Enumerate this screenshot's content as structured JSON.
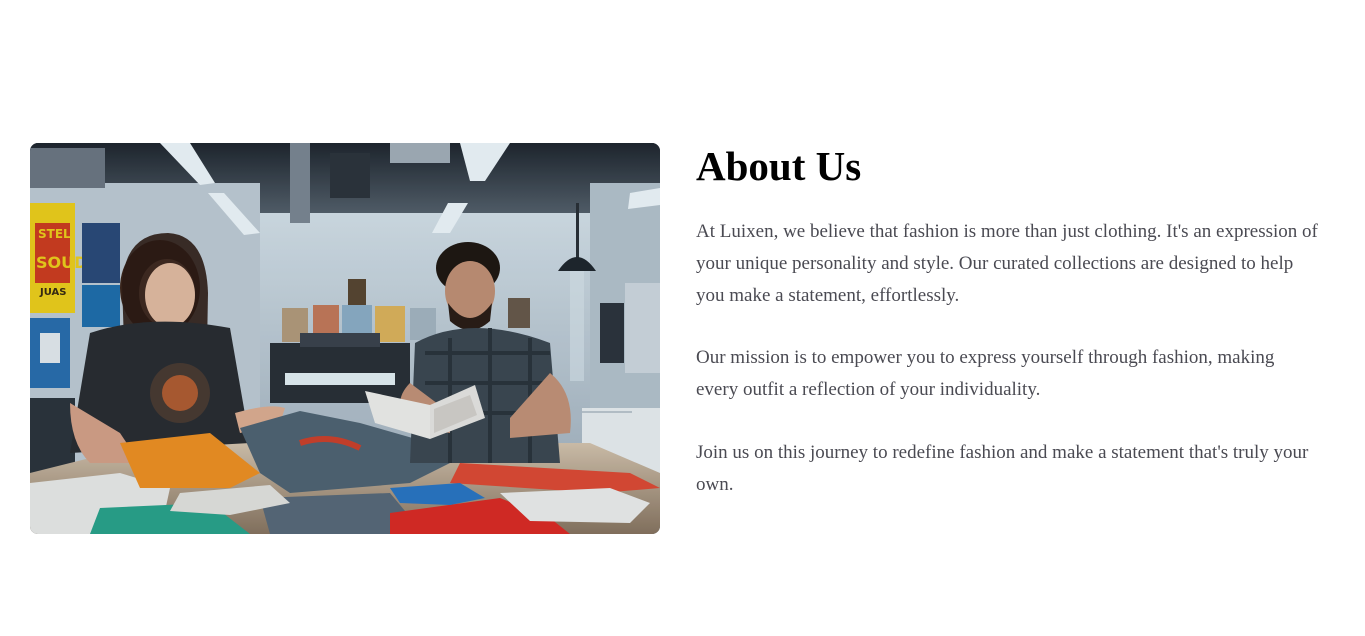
{
  "about": {
    "title": "About Us",
    "paragraphs": [
      "At Luixen, we believe that fashion is more than just clothing. It's an expression of your unique personality and style. Our curated collections are designed to help you make a statement, effortlessly.",
      "Our mission is to empower you to express yourself through fashion, making every outfit a reflection of your individuality.",
      "Join us on this journey to redefine fashion and make a statement that's truly your own."
    ],
    "image": {
      "icon": "workshop-photo",
      "poster_text": "STEL SOUD JUAS"
    }
  },
  "colors": {
    "background": "#ffffff",
    "heading": "#000000",
    "body_text": "#4a4a52"
  }
}
